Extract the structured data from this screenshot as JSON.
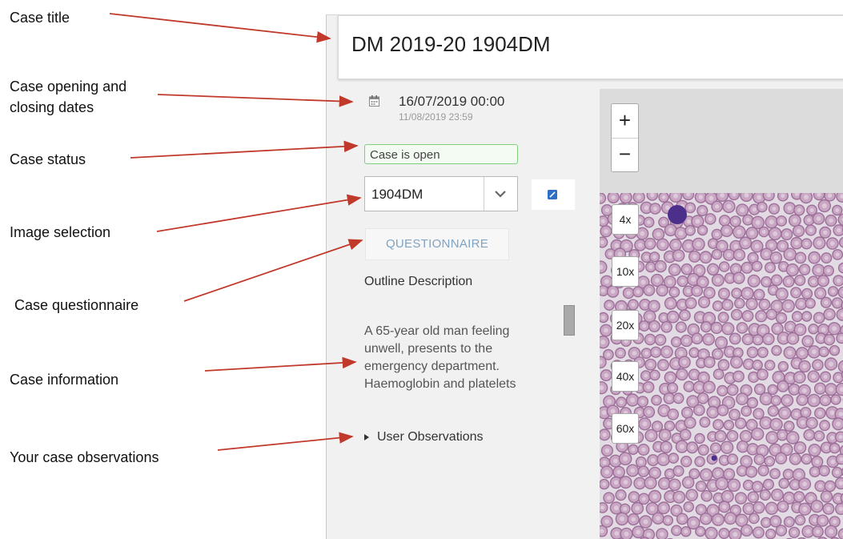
{
  "annotations": {
    "case_title": "Case title",
    "dates_line1": "Case opening and",
    "dates_line2": "closing dates",
    "case_status": "Case status",
    "image_selection": "Image selection",
    "case_questionnaire": "Case questionnaire",
    "case_information": "Case information",
    "your_observations": "Your case observations"
  },
  "app": {
    "title": "DM 2019-20 1904DM",
    "open_date": "16/07/2019 00:00",
    "close_date": "11/08/2019 23:59",
    "status": "Case is open",
    "image_select_value": "1904DM",
    "questionnaire_label": "QUESTIONNAIRE",
    "outline_label": "Outline Description",
    "case_info_lines": [
      "A 65-year old man feeling",
      "unwell, presents to the",
      "emergency department.",
      "Haemoglobin and platelets"
    ],
    "observations_label": "User Observations"
  },
  "viewer": {
    "zoom_in": "+",
    "zoom_out": "−",
    "magnifications": [
      "4x",
      "10x",
      "20x",
      "40x",
      "60x"
    ]
  },
  "colors": {
    "arrow": "#c0392b",
    "status_border": "#7ecf7e",
    "questionnaire_text": "#7fa3c3",
    "cell_fill": "#c9a6c4",
    "cell_rim": "#9c6f98",
    "nucleus": "#4b2f8a"
  },
  "icons": {
    "date": "calendar-icon",
    "select": "chevron-down-icon",
    "edit": "edit-icon",
    "observations": "triangle-right-icon"
  }
}
